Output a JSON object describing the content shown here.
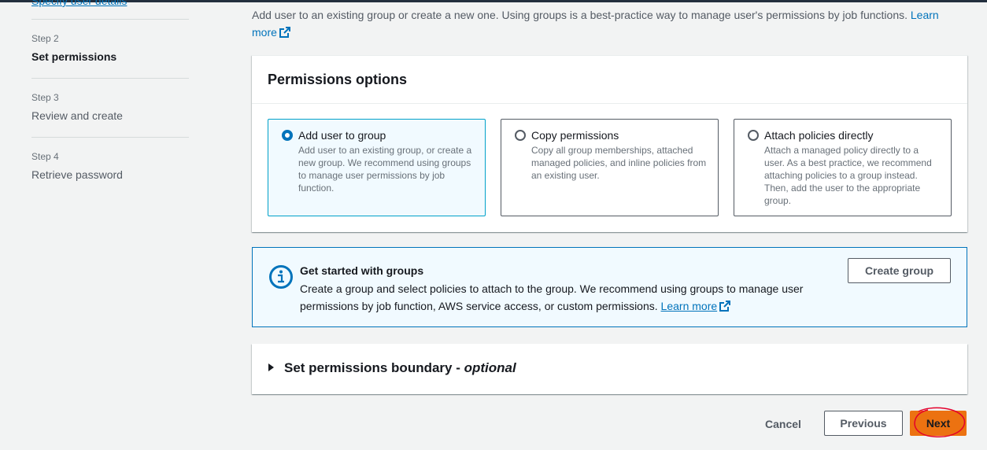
{
  "sidebar": {
    "top_link": "Specify user details",
    "steps": [
      {
        "label": "Step 2",
        "title": "Set permissions",
        "active": true
      },
      {
        "label": "Step 3",
        "title": "Review and create",
        "active": false
      },
      {
        "label": "Step 4",
        "title": "Retrieve password",
        "active": false
      }
    ]
  },
  "intro": {
    "text": "Add user to an existing group or create a new one. Using groups is a best-practice way to manage user's permissions by job functions.",
    "link": "Learn more"
  },
  "permissions": {
    "title": "Permissions options",
    "options": [
      {
        "title": "Add user to group",
        "desc": "Add user to an existing group, or create a new group. We recommend using groups to manage user permissions by job function.",
        "selected": true
      },
      {
        "title": "Copy permissions",
        "desc": "Copy all group memberships, attached managed policies, and inline policies from an existing user.",
        "selected": false
      },
      {
        "title": "Attach policies directly",
        "desc": "Attach a managed policy directly to a user. As a best practice, we recommend attaching policies to a group instead. Then, add the user to the appropriate group.",
        "selected": false
      }
    ]
  },
  "info": {
    "title": "Get started with groups",
    "text": "Create a group and select policies to attach to the group. We recommend using groups to manage user permissions by job function, AWS service access, or custom permissions.",
    "link": "Learn more",
    "button": "Create group"
  },
  "boundary": {
    "title": "Set permissions boundary - ",
    "optional": "optional"
  },
  "footer": {
    "cancel": "Cancel",
    "previous": "Previous",
    "next": "Next"
  },
  "colors": {
    "primary": "#ec7211",
    "link": "#0073bb",
    "annotation": "#e4002b"
  }
}
